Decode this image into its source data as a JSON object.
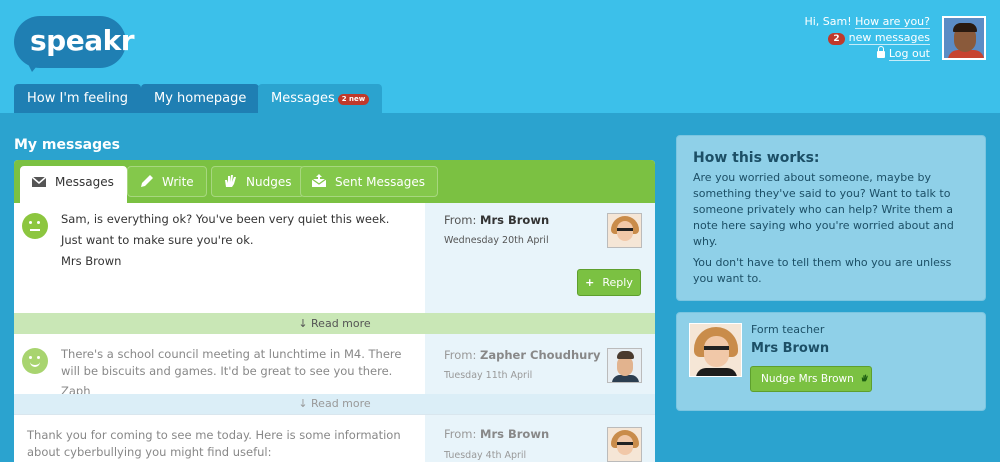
{
  "brand": {
    "logo_text": "speakr"
  },
  "user": {
    "greeting": "Hi, Sam!",
    "mood_link": "How are you?",
    "new_count": "2",
    "new_messages_link": "new messages",
    "logout_link": "Log out"
  },
  "nav": {
    "tabs": [
      {
        "label": "How I'm feeling"
      },
      {
        "label": "My homepage"
      },
      {
        "label": "Messages",
        "badge": "2 new"
      }
    ]
  },
  "main": {
    "title": "My messages",
    "panel_tabs": [
      {
        "label": "Messages",
        "icon": "envelope-icon"
      },
      {
        "label": "Write",
        "icon": "pencil-icon"
      },
      {
        "label": "Nudges",
        "icon": "hand-icon"
      },
      {
        "label": "Sent Messages",
        "icon": "sent-envelope-icon"
      }
    ],
    "messages": [
      {
        "lines": [
          "Sam, is everything ok? You've been very quiet this week.",
          "Just want to make sure you're ok.",
          "Mrs Brown"
        ],
        "from_label": "From:",
        "from_name": "Mrs Brown",
        "date": "Wednesday 20th April",
        "reply_label": "Reply",
        "read_more": "Read more"
      },
      {
        "text": "There's a school council meeting at lunchtime in M4. There will be biscuits and games. It'd be great to see you there.",
        "signoff": "Zaph",
        "from_label": "From:",
        "from_name": "Zapher Choudhury",
        "date": "Tuesday 11th April",
        "read_more": "Read more"
      },
      {
        "text": "Thank you for coming to see me today. Here is some information about cyberbullying you might find useful:",
        "from_label": "From:",
        "from_name": "Mrs Brown",
        "date": "Tuesday 4th April"
      }
    ]
  },
  "sidebar": {
    "how_title": "How this works:",
    "how_p1": "Are you worried about someone, maybe by something they've said to you? Want to talk to someone privately who can help? Write them a note here saying who you're worried about and why.",
    "how_p2": "You don't have to tell them who you are unless you want to.",
    "teacher_role": "Form teacher",
    "teacher_name": "Mrs Brown",
    "nudge_label": "Nudge Mrs Brown"
  },
  "colors": {
    "page_bg": "#2ba3cf",
    "header_bg": "#3cc0ea",
    "tab_bg": "#1f7fb3",
    "green": "#7bc142",
    "badge_red": "#c0392b",
    "info_bg": "#8fd0e8"
  }
}
